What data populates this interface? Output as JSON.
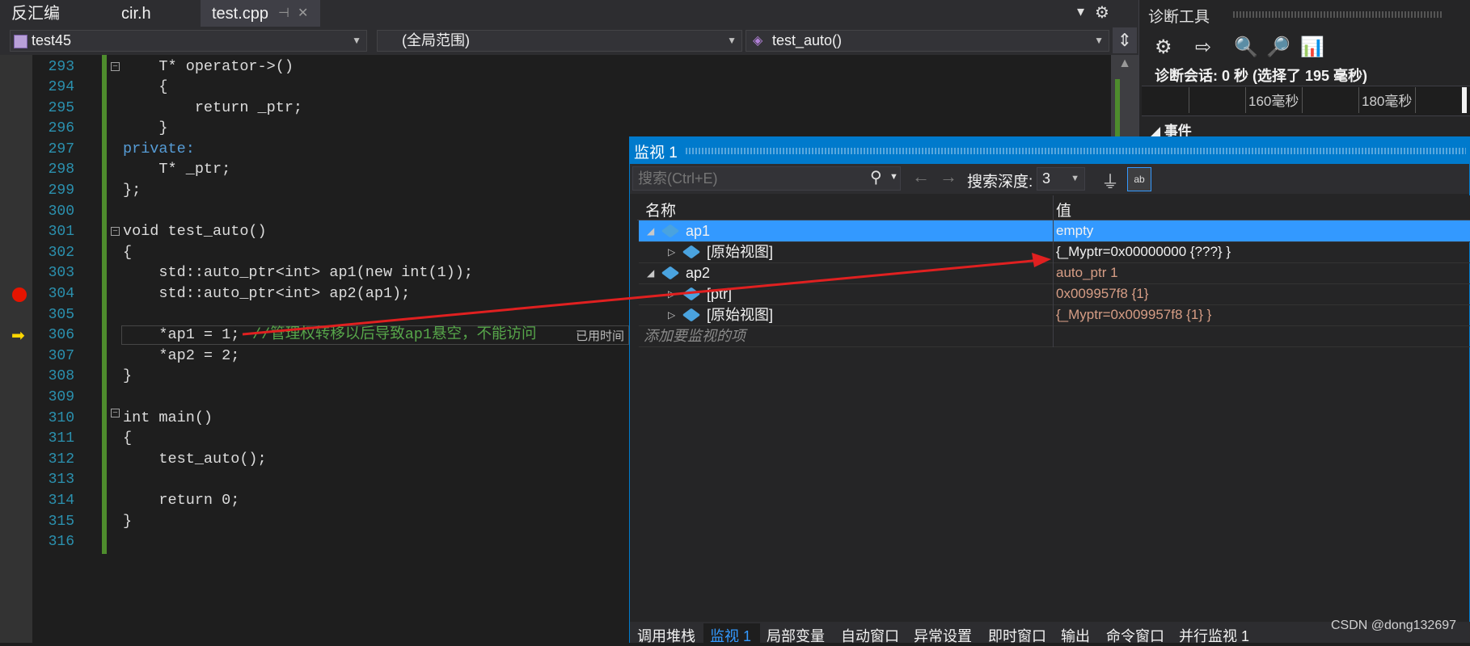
{
  "tabs": [
    {
      "label": "反汇编"
    },
    {
      "label": "cir.h"
    },
    {
      "label": "test.cpp",
      "pin": "⊣",
      "close": "✕"
    }
  ],
  "tab_controls": {
    "dropdown": "▾",
    "gear": "⚙"
  },
  "navbar": {
    "project": "test45",
    "scope": "(全局范围)",
    "member": "test_auto()"
  },
  "editor": {
    "lines": [
      {
        "n": "293",
        "code": "    T* operator->()"
      },
      {
        "n": "294",
        "code": "    {"
      },
      {
        "n": "295",
        "code": "        return _ptr;"
      },
      {
        "n": "296",
        "code": "    }"
      },
      {
        "n": "297",
        "code": "private:"
      },
      {
        "n": "298",
        "code": "    T* _ptr;"
      },
      {
        "n": "299",
        "code": "};"
      },
      {
        "n": "300",
        "code": ""
      },
      {
        "n": "301",
        "code": "void test_auto()"
      },
      {
        "n": "302",
        "code": "{"
      },
      {
        "n": "303",
        "code": "    std::auto_ptr<int> ap1(new int(1));"
      },
      {
        "n": "304",
        "code": "    std::auto_ptr<int> ap2(ap1);"
      },
      {
        "n": "305",
        "code": ""
      },
      {
        "n": "306",
        "code": "    *ap1 = 1;"
      },
      {
        "n": "307",
        "code": "    *ap2 = 2;"
      },
      {
        "n": "308",
        "code": "}"
      },
      {
        "n": "309",
        "code": ""
      },
      {
        "n": "310",
        "code": "int main()"
      },
      {
        "n": "311",
        "code": "{"
      },
      {
        "n": "312",
        "code": "    test_auto();"
      },
      {
        "n": "313",
        "code": ""
      },
      {
        "n": "314",
        "code": "    return 0;"
      },
      {
        "n": "315",
        "code": "}"
      },
      {
        "n": "316",
        "code": ""
      }
    ],
    "comment_306": "//管理权转移以后导致ap1悬空，不能访问",
    "elapsed_hint": "已用时间"
  },
  "diag": {
    "title": "诊断工具",
    "session": "诊断会话: 0 秒 (选择了 195 毫秒)",
    "ruler_labels": [
      "160毫秒",
      "180毫秒"
    ],
    "events_label": "事件",
    "icons": [
      "gear-icon",
      "export-icon",
      "zoom-in-icon",
      "zoom-out-icon",
      "chart-icon"
    ]
  },
  "watch": {
    "title": "监视 1",
    "search_placeholder": "搜索(Ctrl+E)",
    "depth_label": "搜索深度:",
    "depth_value": "3",
    "col_name": "名称",
    "col_value": "值",
    "rows": [
      {
        "name": "ap1",
        "value": "empty",
        "selected": true,
        "level": 0,
        "expander": "◢"
      },
      {
        "name": "[原始视图]",
        "value": "{_Myptr=0x00000000 {???} }",
        "level": 1,
        "expander": "▷"
      },
      {
        "name": "ap2",
        "value": "auto_ptr 1",
        "level": 0,
        "expander": "◢"
      },
      {
        "name": "[ptr]",
        "value": "0x009957f8 {1}",
        "level": 1,
        "expander": "▷"
      },
      {
        "name": "[原始视图]",
        "value": "{_Myptr=0x009957f8 {1} }",
        "level": 1,
        "expander": "▷"
      }
    ],
    "add_item": "添加要监视的项"
  },
  "bottom_tabs": [
    "调用堆栈",
    "监视 1",
    "局部变量",
    "自动窗口",
    "异常设置",
    "即时窗口",
    "输出",
    "命令窗口",
    "并行监视 1"
  ],
  "watermark": "CSDN @dong132697"
}
